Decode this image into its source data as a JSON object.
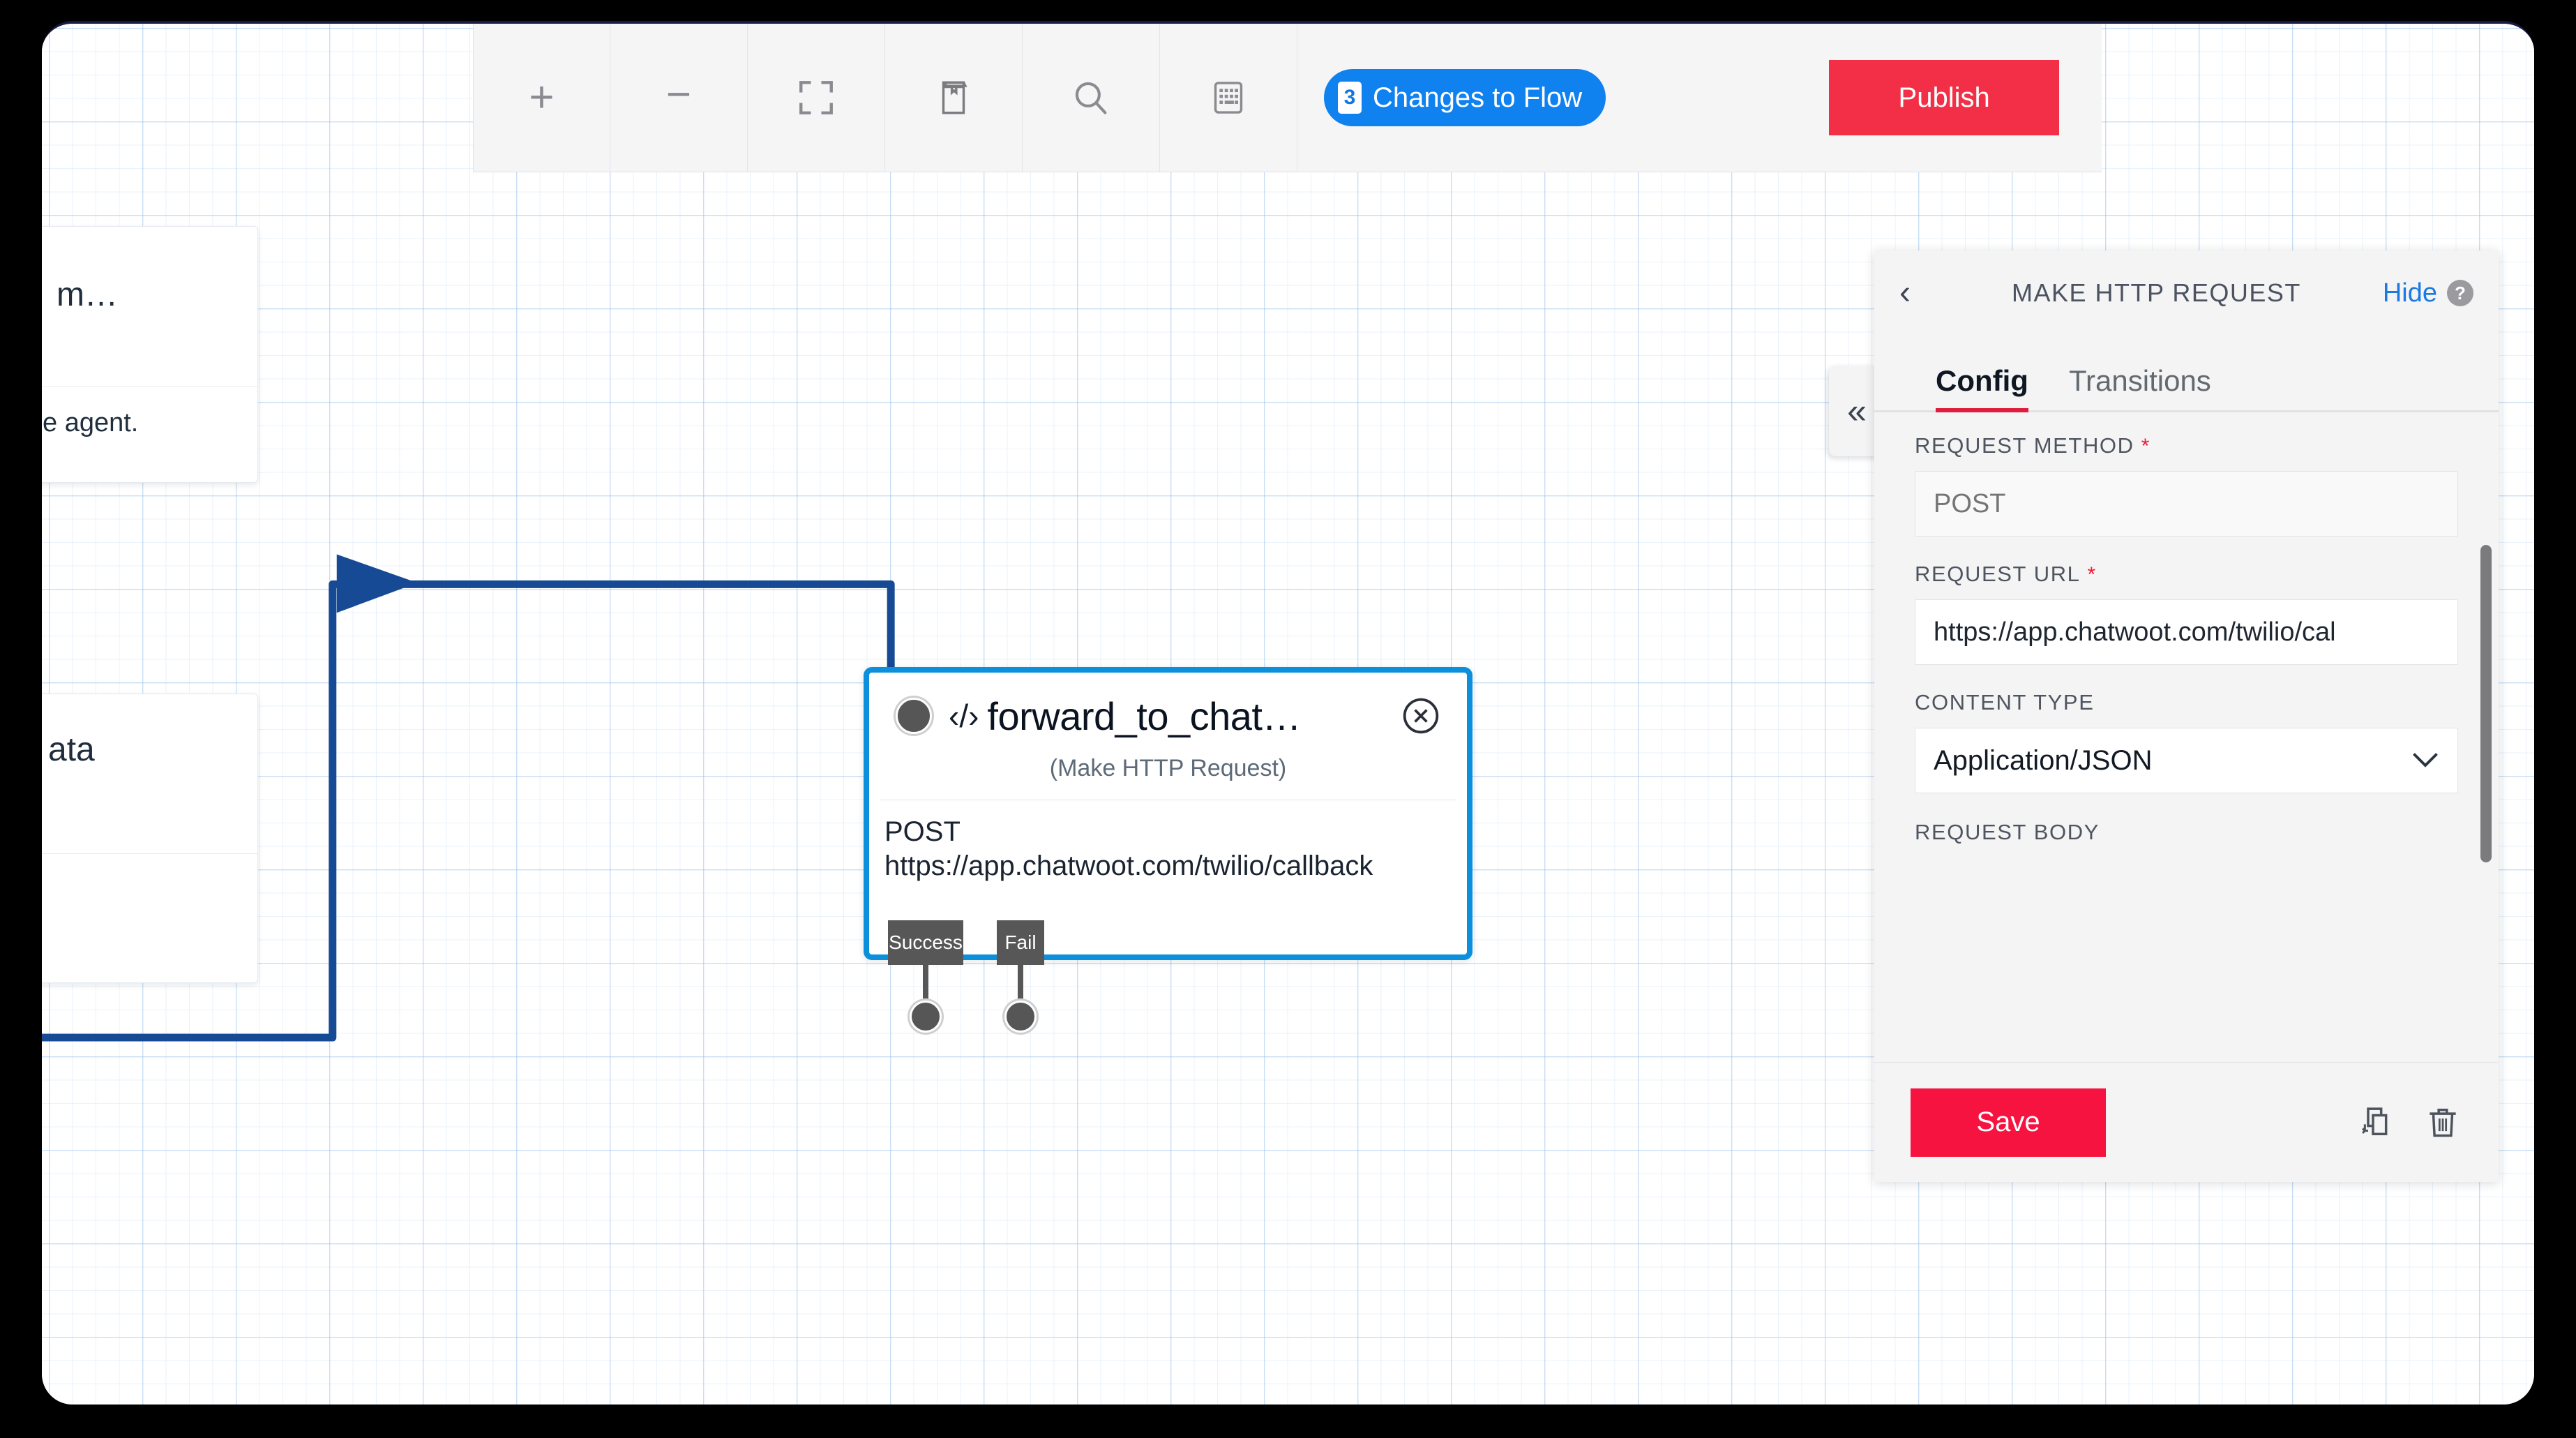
{
  "toolbar": {
    "buttons": [
      {
        "name": "zoom-in",
        "icon": "plus-icon",
        "glyph": "+"
      },
      {
        "name": "zoom-out",
        "icon": "minus-icon",
        "glyph": "−"
      },
      {
        "name": "fit-screen",
        "icon": "fit-screen-icon",
        "glyph": ""
      },
      {
        "name": "library",
        "icon": "book-icon",
        "glyph": ""
      },
      {
        "name": "search",
        "icon": "search-icon",
        "glyph": ""
      },
      {
        "name": "keyboard",
        "icon": "keyboard-icon",
        "glyph": ""
      }
    ],
    "changes_count": "3",
    "changes_label": "Changes to Flow",
    "publish_label": "Publish",
    "accent_blue": "#0f82f0",
    "accent_red": "#f22f46"
  },
  "canvas": {
    "side_cards": [
      {
        "title": "m…",
        "body": "e agent."
      },
      {
        "title": "ata",
        "body": ""
      }
    ],
    "node": {
      "title": "forward_to_chat…",
      "code_icon": "‹/›",
      "subtitle": "(Make HTTP Request)",
      "method": "POST",
      "url": "https://app.chatwoot.com/twilio/callback",
      "outputs": [
        {
          "label": "Success"
        },
        {
          "label": "Fail"
        }
      ],
      "border_color": "#0d90dc"
    },
    "connector_color": "#164a94"
  },
  "panel": {
    "back_glyph": "‹",
    "title": "MAKE HTTP REQUEST",
    "hide_label": "Hide",
    "help_glyph": "?",
    "collapse_glyph": "«",
    "tabs": [
      {
        "label": "Config",
        "active": true
      },
      {
        "label": "Transitions",
        "active": false
      }
    ],
    "fields": [
      {
        "label": "REQUEST METHOD",
        "required": true,
        "type": "text",
        "value": "",
        "placeholder": "POST"
      },
      {
        "label": "REQUEST URL",
        "required": true,
        "type": "text",
        "value": "https://app.chatwoot.com/twilio/cal",
        "placeholder": ""
      },
      {
        "label": "CONTENT TYPE",
        "required": false,
        "type": "select",
        "value": "Application/JSON",
        "options": [
          "Application/JSON"
        ]
      },
      {
        "label": "REQUEST BODY",
        "required": false,
        "type": "label-only",
        "value": ""
      }
    ],
    "footer": {
      "save_label": "Save",
      "actions": [
        {
          "name": "duplicate-icon"
        },
        {
          "name": "delete-icon"
        }
      ]
    },
    "tab_underline_color": "#e01b3c",
    "save_color": "#f7133f"
  }
}
